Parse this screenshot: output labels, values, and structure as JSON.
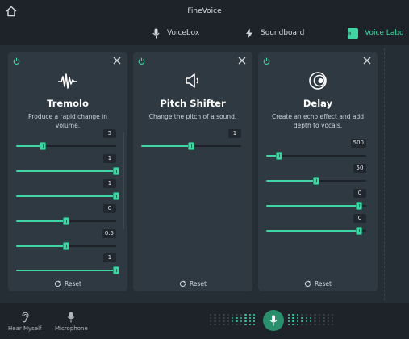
{
  "app": {
    "title": "FineVoice"
  },
  "tabs": [
    {
      "label": "Voicebox",
      "icon": "microphone-icon",
      "active": false
    },
    {
      "label": "Soundboard",
      "icon": "lightning-icon",
      "active": false
    },
    {
      "label": "Voice Labo",
      "icon": "equalizer-icon",
      "active": true
    }
  ],
  "cards": [
    {
      "title": "Tremolo",
      "description": "Produce a rapid change in volume.",
      "icon": "waveform-icon",
      "sliders": [
        {
          "value": "5",
          "level": 0.27
        },
        {
          "value": "1",
          "level": 1.0
        },
        {
          "value": "1",
          "level": 1.0
        },
        {
          "value": "0",
          "level": 0.5
        },
        {
          "value": "0.5",
          "level": 0.5
        },
        {
          "value": "1",
          "level": 1.0
        }
      ],
      "reset_label": "Reset"
    },
    {
      "title": "Pitch Shifter",
      "description": "Change the pitch of a sound.",
      "icon": "speaker-icon",
      "sliders": [
        {
          "value": "1",
          "level": 0.5
        }
      ],
      "reset_label": "Reset"
    },
    {
      "title": "Delay",
      "description": "Create an echo effect and add depth to vocals.",
      "icon": "echo-icon",
      "sliders": [
        {
          "value": "500",
          "level": 0.13
        },
        {
          "value": "50",
          "level": 0.5
        },
        {
          "value": "0",
          "level": 0.93
        },
        {
          "value": "0",
          "level": 0.93
        }
      ],
      "reset_label": "Reset"
    }
  ],
  "bottom": {
    "hear_myself_label": "Hear Myself",
    "microphone_label": "Microphone"
  },
  "colors": {
    "accent": "#3fd6a3",
    "card": "#2f3942",
    "panel": "#252d35",
    "background": "#1d2329"
  }
}
